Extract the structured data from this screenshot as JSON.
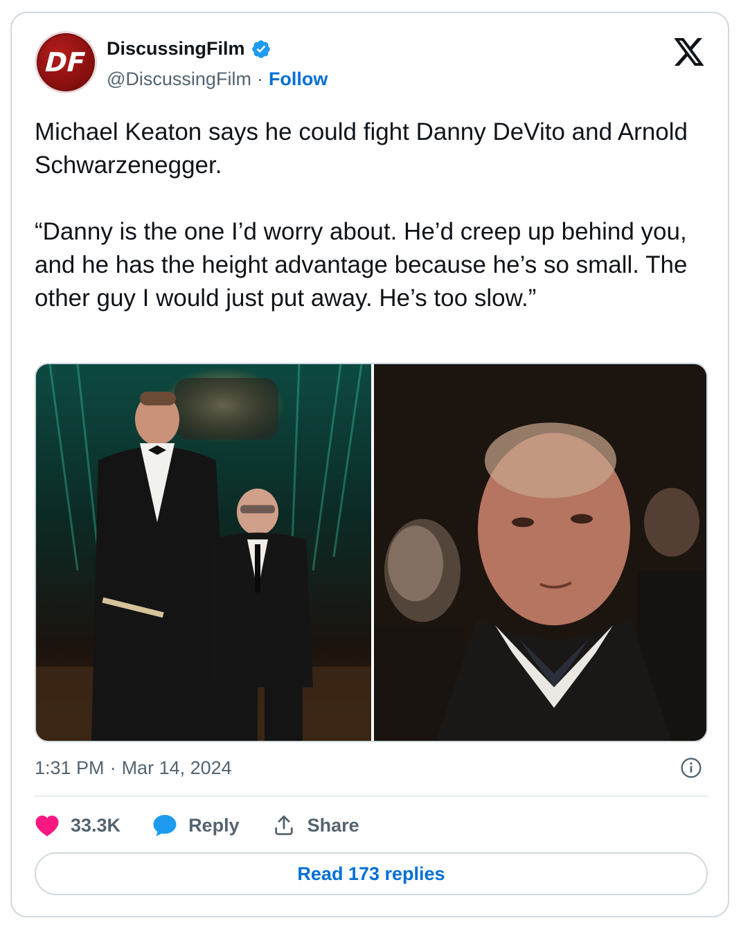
{
  "author": {
    "display_name": "DiscussingFilm",
    "handle": "@DiscussingFilm",
    "separator": "·",
    "follow_label": "Follow",
    "avatar_text": "DF"
  },
  "tweet": {
    "text": "Michael Keaton says he could fight Danny DeVito and Arnold Schwarzenegger.\n\n“Danny is the one I’d worry about. He’d creep up behind you, and he has the height advantage because he’s so small. The other guy I would just put away. He’s too slow.”"
  },
  "meta": {
    "time": "1:31 PM",
    "separator": "·",
    "date": "Mar 14, 2024"
  },
  "actions": {
    "like_count": "33.3K",
    "reply_label": "Reply",
    "share_label": "Share"
  },
  "read_replies_label": "Read 173 replies",
  "colors": {
    "accent": "#006fd6",
    "verified": "#1d9bf0",
    "like": "#f91880",
    "reply": "#1d9bf0",
    "muted": "#536471",
    "border": "#cfd9de"
  },
  "icons": {
    "platform": "x-logo-icon",
    "verified": "verified-badge-icon",
    "info": "info-icon",
    "like": "heart-icon",
    "reply": "speech-bubble-icon",
    "share": "share-upload-icon"
  }
}
